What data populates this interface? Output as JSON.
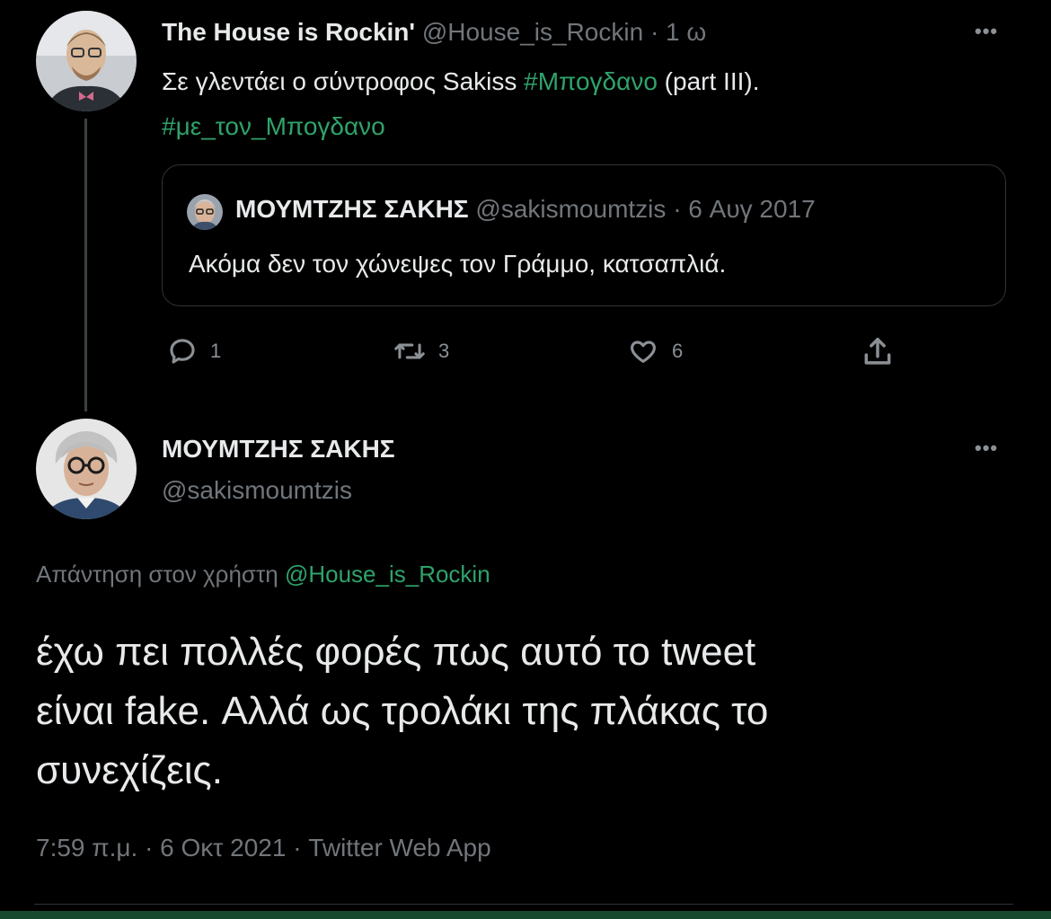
{
  "tweet1": {
    "display_name": "The House is Rockin'",
    "handle": "@House_is_Rockin",
    "sep": "·",
    "time": "1 ω",
    "text_prefix": "Σε γλεντάει ο σύντροφος Sakiss ",
    "hashtag1": "#Μπογδανο",
    "text_suffix": " (part III).",
    "hashtag2": "#με_τον_Μπογδανο",
    "more": "•••",
    "quote": {
      "display_name": "ΜΟΥΜΤΖΗΣ ΣΑΚΗΣ",
      "handle": "@sakismoumtzis",
      "sep": "·",
      "date": "6 Αυγ 2017",
      "text": "Ακόμα δεν τον χώνεψες τον Γράμμο, κατσαπλιά."
    },
    "actions": {
      "replies": "1",
      "retweets": "3",
      "likes": "6"
    }
  },
  "tweet2": {
    "display_name": "ΜΟΥΜΤΖΗΣ ΣΑΚΗΣ",
    "handle": "@sakismoumtzis",
    "more": "•••",
    "reply_label": "Απάντηση στον χρήστη",
    "reply_to": "@House_is_Rockin",
    "text_line1": "έχω πει πολλές φορές πως αυτό το tweet",
    "text_line2": "είναι fake. Αλλά ως τρολάκι της πλάκας το",
    "text_line3": "συνεχίζεις.",
    "timestamp": "7:59 π.μ. · 6 Οκτ 2021 · Twitter Web App"
  },
  "colors": {
    "background": "#000000",
    "accent": "#2fa36b",
    "muted": "#71767b",
    "bottom_bar": "#17492f"
  }
}
